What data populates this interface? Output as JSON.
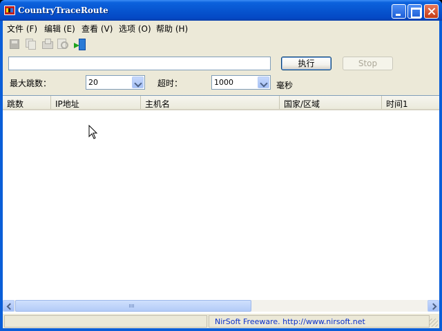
{
  "window": {
    "title": "CountryTraceRoute"
  },
  "menu": [
    {
      "label": "文件 (F)"
    },
    {
      "label": "编辑 (E)"
    },
    {
      "label": "查看 (V)"
    },
    {
      "label": "选项 (O)"
    },
    {
      "label": "帮助 (H)"
    }
  ],
  "toolbar": {
    "icons": [
      "save-icon",
      "copy-icon",
      "properties-icon",
      "find-icon",
      "exit-icon"
    ]
  },
  "form": {
    "destination_value": "",
    "run_label": "执行",
    "stop_label": "Stop",
    "max_hops_label": "最大跳数：",
    "max_hops_value": "20",
    "timeout_label": "超时：",
    "timeout_value": "1000",
    "timeout_unit": "毫秒"
  },
  "table": {
    "columns": [
      "跳数",
      "IP地址",
      "主机名",
      "国家/区域",
      "时间1"
    ],
    "rows": []
  },
  "status": {
    "left": "",
    "link": "NirSoft Freeware.  http://www.nirsoft.net"
  }
}
